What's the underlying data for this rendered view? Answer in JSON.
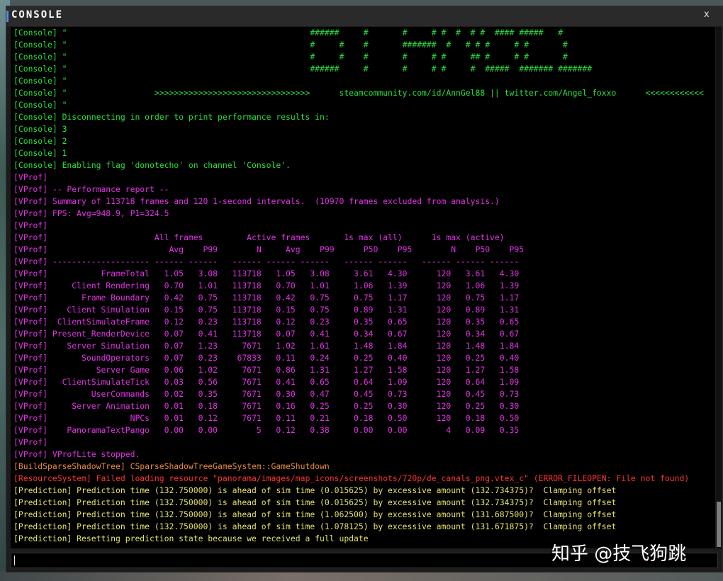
{
  "window": {
    "title": "CONSOLE",
    "close_label": "x"
  },
  "watermark": "知乎 @技飞狗跳",
  "colors": {
    "console": "#27e03a",
    "vprof": "#e233e6",
    "build": "#e88d3b",
    "error": "#ff3333",
    "prediction": "#e8e56a"
  },
  "lines": [
    {
      "type": "console",
      "text": "[Console] \"                                                  ######     #       #     # #  #  # #  #### #####   #"
    },
    {
      "type": "console",
      "text": "[Console] \"                                                  #     #    #       #######  #   # # #     # #       #"
    },
    {
      "type": "console",
      "text": "[Console] \"                                                  #     #    #       #     # #     ## #     # #       #"
    },
    {
      "type": "console",
      "text": "[Console] \"                                                  ######     #       #     # #     #  #####  ####### #######"
    },
    {
      "type": "console",
      "text": "[Console] \""
    },
    {
      "type": "console",
      "text": "[Console] \"                  >>>>>>>>>>>>>>>>>>>>>>>>>>>>>>>>      steamcommunity.com/id/AnnGel88 || twitter.com/Angel_foxxo      <<<<<<<<<<<<"
    },
    {
      "type": "console",
      "text": "[Console] \""
    },
    {
      "type": "console",
      "text": "[Console] Disconnecting in order to print performance results in:"
    },
    {
      "type": "console",
      "text": "[Console] 3"
    },
    {
      "type": "console",
      "text": "[Console] 2"
    },
    {
      "type": "console",
      "text": "[Console] 1"
    },
    {
      "type": "console",
      "text": "[Console] Enabling flag 'donotecho' on channel 'Console'."
    },
    {
      "type": "vprof",
      "text": "[VProf]"
    },
    {
      "type": "vprof",
      "text": "[VProf] -- Performance report --"
    },
    {
      "type": "vprof",
      "text": "[VProf] Summary of 113718 frames and 120 1-second intervals.  (10970 frames excluded from analysis.)"
    },
    {
      "type": "vprof",
      "text": "[VProf] FPS: Avg=948.9, P1=324.5"
    },
    {
      "type": "vprof",
      "text": "[VProf]"
    },
    {
      "type": "vprof",
      "text": "[VProf]                      All frames         Active frames       1s max (all)      1s max (active)"
    },
    {
      "type": "vprof",
      "text": "[VProf]                         Avg    P99        N     Avg    P99      P50    P95        N    P50    P95"
    },
    {
      "type": "vprof",
      "text": "[VProf] -------------------- ------ ------   ------ ------ ------   ------ ------   ------ ------ ------"
    },
    {
      "type": "vprof",
      "text": "[VProf]           FrameTotal   1.05   3.08   113718   1.05   3.08     3.61   4.30      120   3.61   4.30"
    },
    {
      "type": "vprof",
      "text": "[VProf]     Client Rendering   0.70   1.01   113718   0.70   1.01     1.06   1.39      120   1.06   1.39"
    },
    {
      "type": "vprof",
      "text": "[VProf]       Frame Boundary   0.42   0.75   113718   0.42   0.75     0.75   1.17      120   0.75   1.17"
    },
    {
      "type": "vprof",
      "text": "[VProf]    Client Simulation   0.15   0.75   113718   0.15   0.75     0.89   1.31      120   0.89   1.31"
    },
    {
      "type": "vprof",
      "text": "[VProf]  ClientSimulateFrame   0.12   0.23   113718   0.12   0.23     0.35   0.65      120   0.35   0.65"
    },
    {
      "type": "vprof",
      "text": "[VProf] Present_RenderDevice   0.07   0.41   113718   0.07   0.41     0.34   0.67      120   0.34   0.67"
    },
    {
      "type": "vprof",
      "text": "[VProf]    Server Simulation   0.07   1.23     7671   1.02   1.61     1.48   1.84      120   1.48   1.84"
    },
    {
      "type": "vprof",
      "text": "[VProf]       SoundOperators   0.07   0.23    67833   0.11   0.24     0.25   0.40      120   0.25   0.40"
    },
    {
      "type": "vprof",
      "text": "[VProf]          Server Game   0.06   1.02     7671   0.86   1.31     1.27   1.58      120   1.27   1.58"
    },
    {
      "type": "vprof",
      "text": "[VProf]   ClientSimulateTick   0.03   0.56     7671   0.41   0.65     0.64   1.09      120   0.64   1.09"
    },
    {
      "type": "vprof",
      "text": "[VProf]         UserCommands   0.02   0.35     7671   0.30   0.47     0.45   0.73      120   0.45   0.73"
    },
    {
      "type": "vprof",
      "text": "[VProf]     Server Animation   0.01   0.18     7671   0.16   0.25     0.25   0.30      120   0.25   0.30"
    },
    {
      "type": "vprof",
      "text": "[VProf]                 NPCs   0.01   0.12     7671   0.11   0.21     0.18   0.50      120   0.18   0.50"
    },
    {
      "type": "vprof",
      "text": "[VProf]    PanoramaTextPango   0.00   0.00        5   0.12   0.38     0.00   0.00        4   0.09   0.35"
    },
    {
      "type": "vprof",
      "text": "[VProf]"
    },
    {
      "type": "vprof",
      "text": "[VProf] VProfLite stopped."
    },
    {
      "type": "build",
      "text": "[BuildSparseShadowTree] CSparseShadowTreeGameSystem::GameShutdown"
    },
    {
      "type": "error",
      "text": "[ResourceSystem] Failed loading resource \"panorama/images/map_icons/screenshots/720p/de_canals_png.vtex_c\" (ERROR_FILEOPEN: File not found)"
    },
    {
      "type": "prediction",
      "text": "[Prediction] Prediction time (132.750000) is ahead of sim time (0.015625) by excessive amount (132.734375)?  Clamping offset"
    },
    {
      "type": "prediction",
      "text": "[Prediction] Prediction time (132.750000) is ahead of sim time (0.015625) by excessive amount (132.734375)?  Clamping offset"
    },
    {
      "type": "prediction",
      "text": "[Prediction] Prediction time (132.750000) is ahead of sim time (1.062500) by excessive amount (131.687500)?  Clamping offset"
    },
    {
      "type": "prediction",
      "text": "[Prediction] Prediction time (132.750000) is ahead of sim time (1.078125) by excessive amount (131.671875)?  Clamping offset"
    },
    {
      "type": "prediction",
      "text": "[Prediction] Resetting prediction state because we received a full update"
    }
  ],
  "input": {
    "value": ""
  }
}
